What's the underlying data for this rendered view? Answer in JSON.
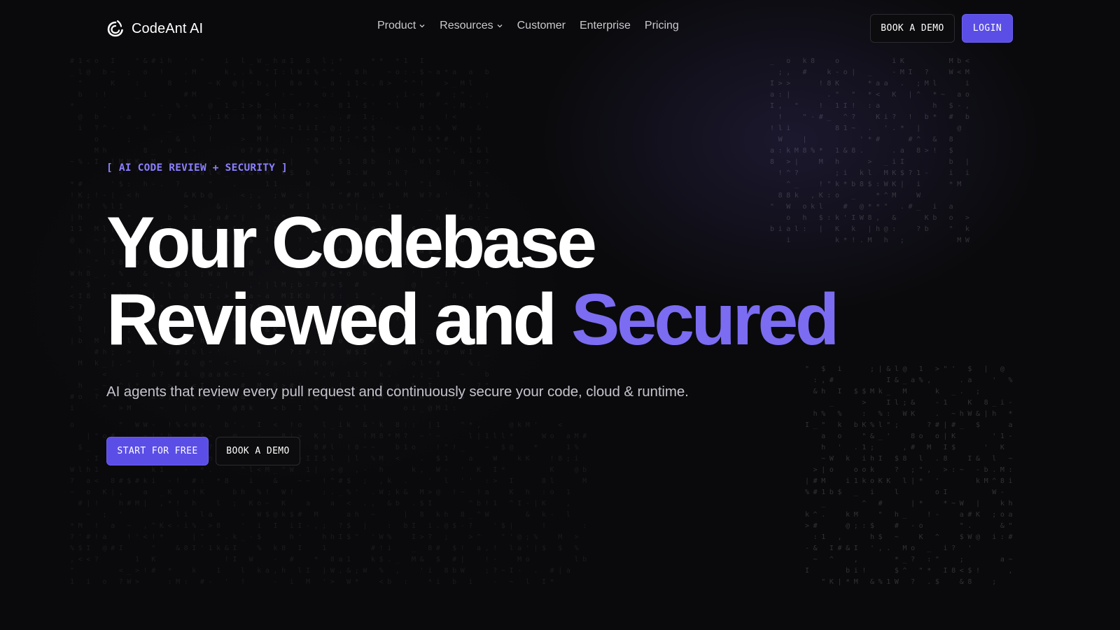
{
  "brand": {
    "name": "CodeAnt AI",
    "icon": "codeant-logo-icon"
  },
  "nav": {
    "items": [
      {
        "label": "Product",
        "has_dropdown": true
      },
      {
        "label": "Resources",
        "has_dropdown": true
      },
      {
        "label": "Customer",
        "has_dropdown": false
      },
      {
        "label": "Enterprise",
        "has_dropdown": false
      },
      {
        "label": "Pricing",
        "has_dropdown": false
      }
    ],
    "book_demo_label": "BOOK A DEMO",
    "login_label": "LOGIN"
  },
  "hero": {
    "eyebrow": "[ AI CODE REVIEW + SECURITY ]",
    "headline_line1": "Your Codebase",
    "headline_line2_plain": "Reviewed and",
    "headline_line2_accent": "Secured",
    "subtitle": "AI agents that review every pull request and continuously secure your code, cloud & runtime.",
    "primary_cta": "START FOR FREE",
    "secondary_cta": "BOOK A DEMO"
  },
  "colors": {
    "background": "#0a0a0c",
    "accent": "#7b6cf2",
    "button_primary": "#5b4ee6",
    "eyebrow": "#8b80ff"
  }
}
